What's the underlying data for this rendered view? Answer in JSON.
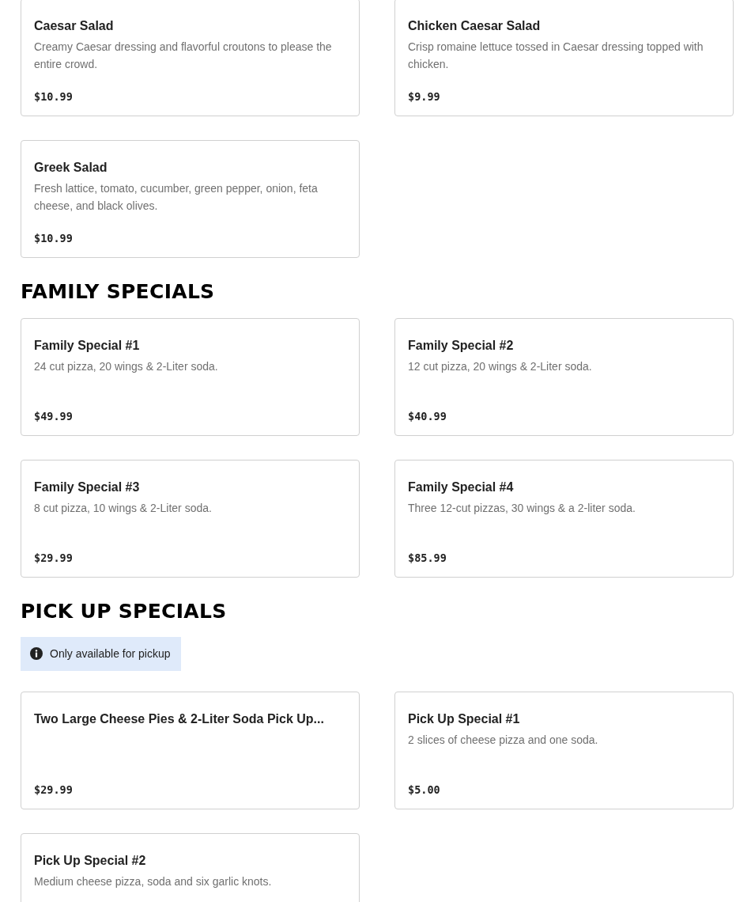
{
  "sections": [
    {
      "items": [
        {
          "name": "Caesar Salad",
          "description": "Creamy Caesar dressing and flavorful croutons to please the entire crowd.",
          "price": "$10.99"
        },
        {
          "name": "Chicken Caesar Salad",
          "description": "Crisp romaine lettuce tossed in Caesar dressing topped with chicken.",
          "price": "$9.99"
        },
        {
          "name": "Greek Salad",
          "description": "Fresh lattice, tomato, cucumber, green pepper, onion, feta cheese, and black olives.",
          "price": "$10.99"
        }
      ]
    },
    {
      "heading": "FAMILY SPECIALS",
      "items": [
        {
          "name": "Family Special #1",
          "description": "24 cut pizza, 20 wings & 2-Liter soda.",
          "price": "$49.99"
        },
        {
          "name": "Family Special #2",
          "description": "12 cut pizza, 20 wings & 2-Liter soda.",
          "price": "$40.99"
        },
        {
          "name": "Family Special #3",
          "description": "8 cut pizza, 10 wings & 2-Liter soda.",
          "price": "$29.99"
        },
        {
          "name": "Family Special #4",
          "description": "Three 12-cut pizzas, 30 wings & a 2-liter soda.",
          "price": "$85.99"
        }
      ]
    },
    {
      "heading": "PICK UP SPECIALS",
      "notice": "Only available for pickup",
      "items": [
        {
          "name": "Two Large Cheese Pies & 2-Liter Soda Pick Up...",
          "price": "$29.99"
        },
        {
          "name": "Pick Up Special #1",
          "description": "2 slices of cheese pizza and one soda.",
          "price": "$5.00"
        },
        {
          "name": "Pick Up Special #2",
          "description": "Medium cheese pizza, soda and six garlic knots."
        }
      ]
    }
  ]
}
